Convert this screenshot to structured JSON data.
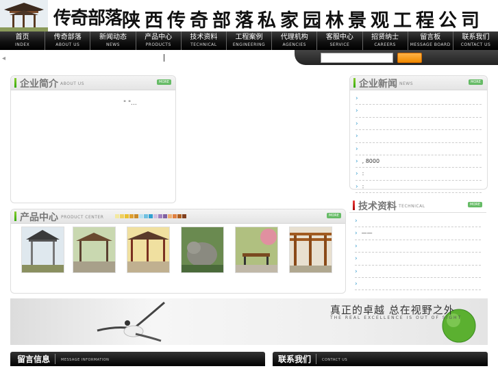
{
  "header": {
    "logo_text": "传奇部落",
    "company_name": "陕西传奇部落私家园林景观工程公司"
  },
  "nav": [
    {
      "zh": "首页",
      "en": "INDEX"
    },
    {
      "zh": "传奇部落",
      "en": "ABOUT US"
    },
    {
      "zh": "新闻动态",
      "en": "NEWS"
    },
    {
      "zh": "产品中心",
      "en": "PRODUCTS"
    },
    {
      "zh": "技术资料",
      "en": "TECHNICAL"
    },
    {
      "zh": "工程案例",
      "en": "ENGINEERING"
    },
    {
      "zh": "代理机构",
      "en": "AGENCIES"
    },
    {
      "zh": "客服中心",
      "en": "SERVICE"
    },
    {
      "zh": "招贤纳士",
      "en": "CAREERS"
    },
    {
      "zh": "留言板",
      "en": "MESSAGE BOARD"
    },
    {
      "zh": "联系我们",
      "en": "CONTACT US"
    }
  ],
  "about": {
    "title": "企业简介",
    "title_en": "ABOUT US",
    "more": "MORE",
    "text": "\" \"..."
  },
  "news": {
    "title": "企业新闻",
    "title_en": "NEWS",
    "more": "MORE",
    "items": [
      "",
      "",
      "",
      "",
      "",
      ", 8000",
      ":",
      ":"
    ]
  },
  "tech": {
    "title": "技术资料",
    "title_en": "TECHNICAL",
    "more": "MORE",
    "items": [
      "",
      "——",
      "",
      "",
      "",
      ""
    ]
  },
  "products": {
    "title": "产品中心",
    "title_en": "PRODUCT CENTER",
    "more": "MORE"
  },
  "banner": {
    "slogan": "真正的卓越 总在视野之外",
    "sub": "THE REAL EXCELLENCE IS OUT OF SIGHT"
  },
  "footer": {
    "message_title": "留言信息",
    "message_en": "MESSAGE INFORMATION",
    "contact_title": "联系我们",
    "contact_en": "CONTACT US"
  },
  "colors": {
    "accent_orange": "#f08a00",
    "nav_dark": "#111111",
    "more_green": "#66bb66"
  }
}
